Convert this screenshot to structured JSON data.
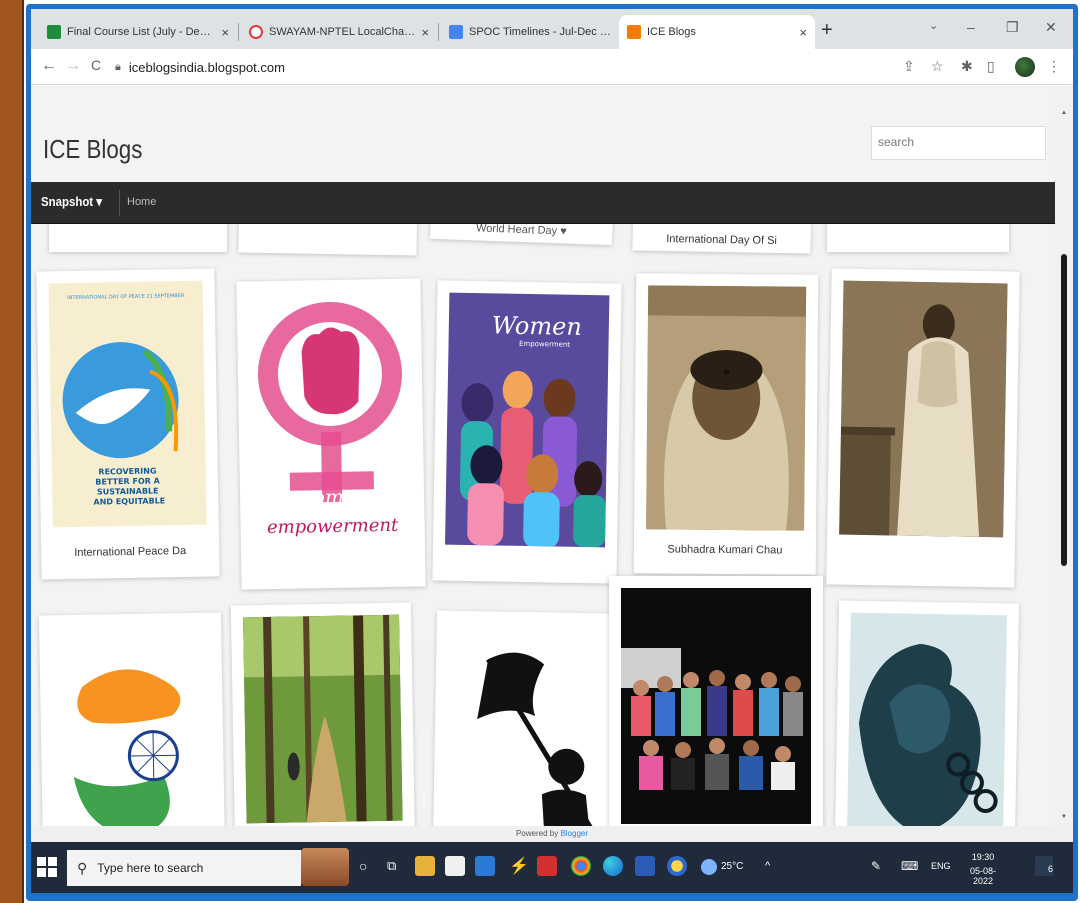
{
  "browser": {
    "tabs": [
      {
        "title": "Final Course List (July - Dec 202...",
        "favicon_color": "#1e8e3e",
        "active": false
      },
      {
        "title": "SWAYAM-NPTEL LocalChapter",
        "favicon_color": "#e53935",
        "active": false
      },
      {
        "title": "SPOC Timelines - Jul-Dec 2022",
        "favicon_color": "#4285f4",
        "active": false
      },
      {
        "title": "ICE Blogs",
        "favicon_color": "#f57c00",
        "active": true
      }
    ],
    "close_glyph": "×",
    "new_tab_glyph": "+",
    "url": "iceblogsindia.blogspot.com",
    "nav": {
      "back": "←",
      "forward": "→",
      "reload": "C"
    }
  },
  "blog": {
    "title": "ICE Blogs",
    "search_placeholder": "search",
    "menu_label": "Snapshot ▾",
    "home_label": "Home",
    "footer_prefix": "Powered by ",
    "footer_link": "Blogger"
  },
  "cards": [
    {
      "caption": ""
    },
    {
      "caption": ""
    },
    {
      "caption": "World Heart Day ♥"
    },
    {
      "caption": "International Day Of Si"
    },
    {
      "caption": ""
    },
    {
      "caption": "International Peace Da",
      "poster_text": "RECOVERING BETTER FOR A SUSTAINABLE AND EQUITABLE",
      "poster_header": "INTERNATIONAL DAY OF PEACE 21 SEPTEMBER"
    },
    {
      "caption": "",
      "script_text": "women empowerment"
    },
    {
      "caption": "",
      "poster_title": "Women",
      "poster_subtitle": "Empowerment"
    },
    {
      "caption": "Subhadra Kumari Chau"
    },
    {
      "caption": ""
    },
    {
      "caption": ""
    },
    {
      "caption": ""
    },
    {
      "caption": ""
    },
    {
      "caption": ""
    },
    {
      "caption": ""
    }
  ],
  "taskbar": {
    "search_placeholder": "Type here to search",
    "weather": "25°C",
    "language": "ENG",
    "time": "19:30",
    "date": "05-08-2022",
    "notification_count": "6"
  },
  "colors": {
    "navbar": "#2b2b2b",
    "page_bg": "#f3f3f3",
    "taskbar": "#1f2a3a",
    "frame_blue": "#1e73c8",
    "frame_brown": "#a0561e"
  }
}
